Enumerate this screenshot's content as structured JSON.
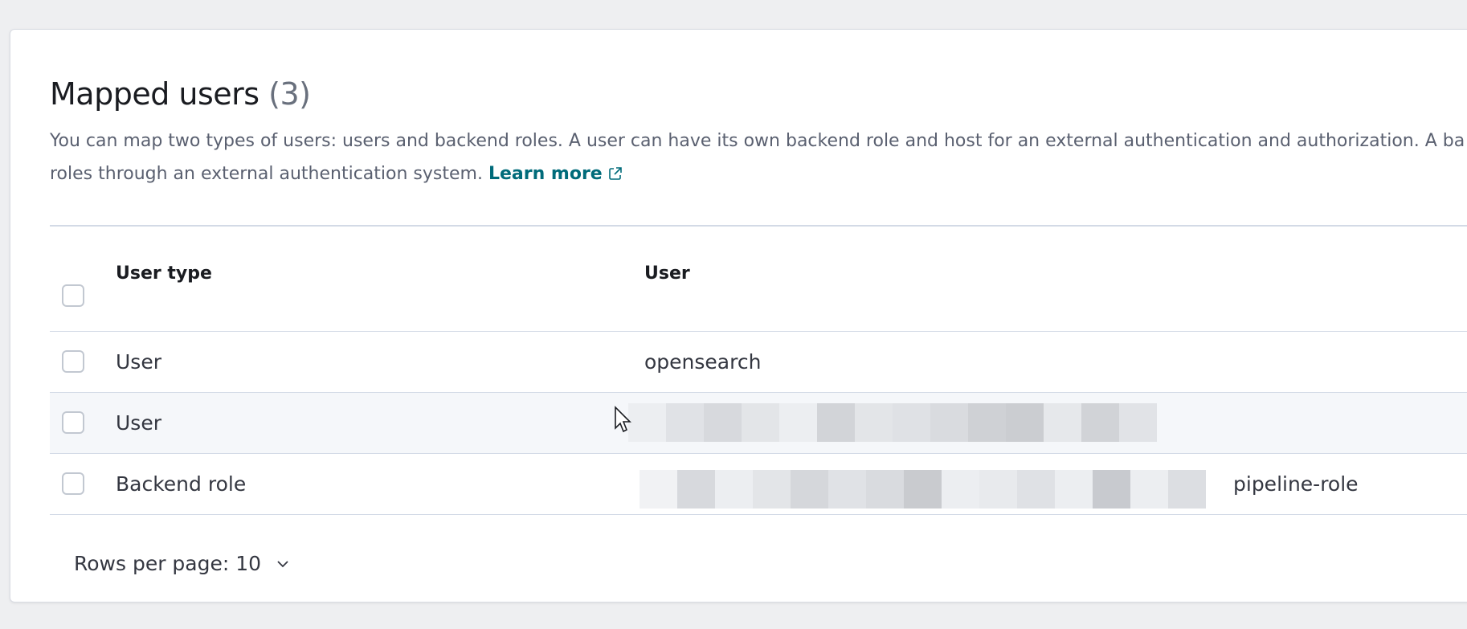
{
  "section": {
    "title": "Mapped users",
    "count": "(3)",
    "description_line1": "You can map two types of users: users and backend roles. A user can have its own backend role and host for an external authentication and authorization. A ba",
    "description_line2": "roles through an external authentication system.",
    "learn_more": "Learn more",
    "learn_more_icon": "external-link-icon"
  },
  "table": {
    "columns": [
      "User type",
      "User"
    ],
    "rows": [
      {
        "user_type": "User",
        "user": "opensearch",
        "redacted": false
      },
      {
        "user_type": "User",
        "user": "",
        "redacted": true
      },
      {
        "user_type": "Backend role",
        "user": "pipeline-role",
        "redacted": true
      }
    ]
  },
  "pagination": {
    "rows_per_page_label": "Rows per page: 10",
    "icon": "chevron-down-icon"
  },
  "colors": {
    "link": "#006b7a",
    "border": "#d3dae6",
    "hover_row": "#f5f7fa"
  }
}
